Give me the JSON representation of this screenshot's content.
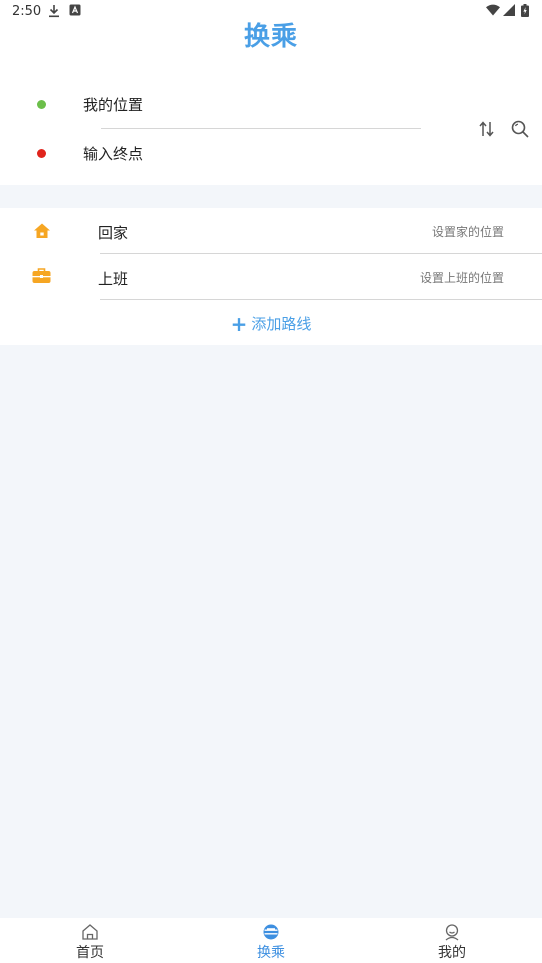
{
  "status_bar": {
    "time": "2:50",
    "icons": [
      "download-icon",
      "notification-a-icon",
      "wifi-icon",
      "signal-icon",
      "battery-icon"
    ]
  },
  "header": {
    "title": "换乘"
  },
  "route_input": {
    "origin": "我的位置",
    "destination_placeholder": "输入终点",
    "origin_dot_color": "#6cbf4a",
    "destination_dot_color": "#e0241c"
  },
  "shortcuts": {
    "items": [
      {
        "label": "回家",
        "hint": "设置家的位置",
        "icon": "home-icon"
      },
      {
        "label": "上班",
        "hint": "设置上班的位置",
        "icon": "briefcase-icon"
      }
    ],
    "add_route_label": "添加路线"
  },
  "tab_bar": {
    "tabs": [
      {
        "label": "首页",
        "icon": "home-outline-icon",
        "active": false
      },
      {
        "label": "换乘",
        "icon": "transfer-icon",
        "active": true
      },
      {
        "label": "我的",
        "icon": "profile-icon",
        "active": false
      }
    ]
  },
  "colors": {
    "accent": "#4a9fe6",
    "shortcut_icon": "#f6a623",
    "background": "#f3f6fa"
  }
}
